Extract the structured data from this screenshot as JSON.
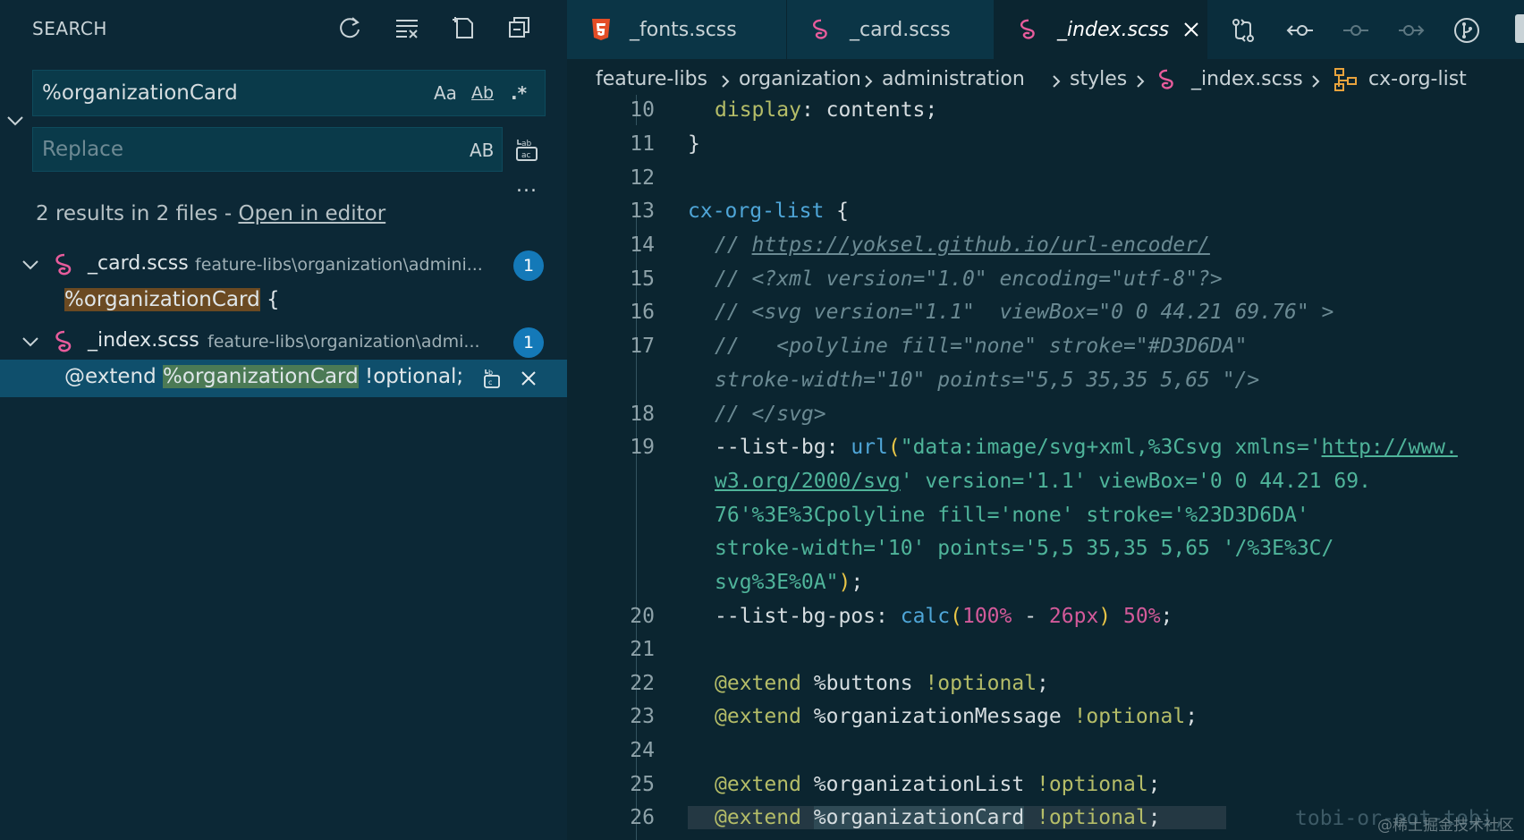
{
  "sidebar": {
    "title": "SEARCH",
    "actions": [
      "refresh-icon",
      "clear-results-icon",
      "new-search-editor-icon",
      "collapse-all-icon"
    ],
    "search": {
      "value": "%organizationCard",
      "opt_case": "Aa",
      "opt_word": "Ab",
      "opt_regex": ".*"
    },
    "replace": {
      "placeholder": "Replace",
      "opt_preserve_case": "AB"
    },
    "more": "...",
    "results_prefix": "2 results in 2 files - ",
    "open_in_editor": "Open in editor",
    "files": [
      {
        "name": "_card.scss",
        "path": "feature-libs\\organization\\admini...",
        "count": "1",
        "match": {
          "hit": "%organizationCard",
          "after": " {"
        }
      },
      {
        "name": "_index.scss",
        "path": "feature-libs\\organization\\admi...",
        "count": "1",
        "match": {
          "before": "@extend ",
          "hit": "%organizationCard",
          "after": " !optional;"
        }
      }
    ]
  },
  "tabs": [
    {
      "label": "_fonts.scss",
      "icon": "html5-icon"
    },
    {
      "label": "_card.scss",
      "icon": "sass-icon"
    },
    {
      "label": "_index.scss",
      "icon": "sass-icon",
      "active": true
    }
  ],
  "editor_actions": [
    "compare-changes-icon",
    "go-back-change-icon",
    "current-change-icon",
    "go-forward-change-icon",
    "git-graph-icon"
  ],
  "breadcrumb": [
    "feature-libs",
    "organization",
    "administration",
    "styles",
    "_index.scss",
    "cx-org-list"
  ],
  "code": {
    "line_numbers": [
      "10",
      "11",
      "12",
      "13",
      "14",
      "15",
      "16",
      "17",
      "18",
      "19",
      "20",
      "21",
      "22",
      "23",
      "24",
      "25",
      "26"
    ],
    "l10_prop": "display",
    "l10_rest": ": contents;",
    "l11": "}",
    "l13_sel": "cx-org-list",
    "l13_rest": " {",
    "l14_prefix": "// ",
    "l14_url": "https://yoksel.github.io/url-encoder/",
    "l15": "// <?xml version=\"1.0\" encoding=\"utf-8\"?>",
    "l16": "// <svg version=\"1.1\"  viewBox=\"0 0 44.21 69.76\" >",
    "l17a": "//   <polyline fill=\"none\" stroke=\"#D3D6DA\"",
    "l17b": "stroke-width=\"10\" points=\"5,5 35,35 5,65 \"/>",
    "l18": "// </svg>",
    "l19_var": "--list-bg",
    "l19_colon": ": ",
    "l19_func": "url",
    "l19_open": "(",
    "l19_str1": "\"data:image/svg+xml,%3Csvg xmlns='",
    "l19_url1": "http://www.",
    "l19_url2": "w3.org/2000/svg",
    "l19_str2": "' version='1.1' viewBox='0 0 44.21 69.",
    "l19_str3": "76'%3E%3Cpolyline fill='none' stroke='%23D3D6DA'",
    "l19_str4": "stroke-width='10' points='5,5 35,35 5,65 '/%3E%3C/",
    "l19_str5": "svg%3E%0A\"",
    "l19_close": ")",
    "l19_end": ";",
    "l20_var": "--list-bg-pos",
    "l20_colon": ": ",
    "l20_func": "calc",
    "l20_open": "(",
    "l20_n1": "100%",
    "l20_op": " - ",
    "l20_n2": "26px",
    "l20_close": ")",
    "l20_n3": " 50%",
    "l20_end": ";",
    "l22_kw": "@extend",
    "l22_ph": " %buttons ",
    "l22_opt": "!optional",
    "l22_end": ";",
    "l23_kw": "@extend",
    "l23_ph": " %organizationMessage ",
    "l23_opt": "!optional",
    "l23_end": ";",
    "l25_kw": "@extend",
    "l25_ph": " %organizationList ",
    "l25_opt": "!optional",
    "l25_end": ";",
    "l26_kw": "@extend",
    "l26_sp": " ",
    "l26_ph": "%organizationCard",
    "l26_opt": " !optional",
    "l26_end": ";",
    "blame_ghost": "tobi-or-not-tobi,"
  },
  "watermark": "@稀土掘金技术社区",
  "colors": {
    "sidebar_bg": "#0c2836",
    "editor_bg": "#0b2530",
    "accent": "#1479b8",
    "sass": "#e85c9c",
    "html5": "#e44d26"
  }
}
